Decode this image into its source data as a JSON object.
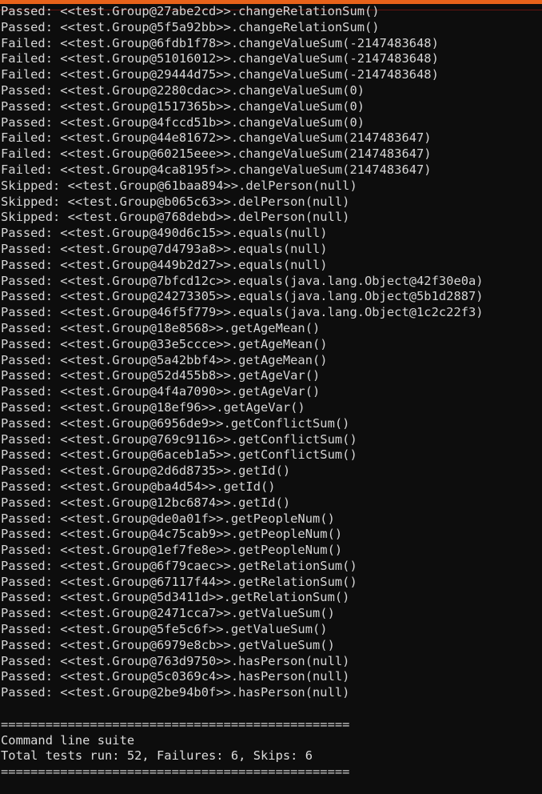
{
  "terminal": {
    "accent_color": "#e8621a",
    "background_color": "#0d0d0d",
    "text_color": "#d6d6d6",
    "font_label": "monospace-console"
  },
  "results": {
    "lines": [
      "Passed: <<test.Group@27abe2cd>>.changeRelationSum()",
      "Passed: <<test.Group@5f5a92bb>>.changeRelationSum()",
      "Failed: <<test.Group@6fdb1f78>>.changeValueSum(-2147483648)",
      "Failed: <<test.Group@51016012>>.changeValueSum(-2147483648)",
      "Failed: <<test.Group@29444d75>>.changeValueSum(-2147483648)",
      "Passed: <<test.Group@2280cdac>>.changeValueSum(0)",
      "Passed: <<test.Group@1517365b>>.changeValueSum(0)",
      "Passed: <<test.Group@4fccd51b>>.changeValueSum(0)",
      "Failed: <<test.Group@44e81672>>.changeValueSum(2147483647)",
      "Failed: <<test.Group@60215eee>>.changeValueSum(2147483647)",
      "Failed: <<test.Group@4ca8195f>>.changeValueSum(2147483647)",
      "Skipped: <<test.Group@61baa894>>.delPerson(null)",
      "Skipped: <<test.Group@b065c63>>.delPerson(null)",
      "Skipped: <<test.Group@768debd>>.delPerson(null)",
      "Passed: <<test.Group@490d6c15>>.equals(null)",
      "Passed: <<test.Group@7d4793a8>>.equals(null)",
      "Passed: <<test.Group@449b2d27>>.equals(null)",
      "Passed: <<test.Group@7bfcd12c>>.equals(java.lang.Object@42f30e0a)",
      "Passed: <<test.Group@24273305>>.equals(java.lang.Object@5b1d2887)",
      "Passed: <<test.Group@46f5f779>>.equals(java.lang.Object@1c2c22f3)",
      "Passed: <<test.Group@18e8568>>.getAgeMean()",
      "Passed: <<test.Group@33e5ccce>>.getAgeMean()",
      "Passed: <<test.Group@5a42bbf4>>.getAgeMean()",
      "Passed: <<test.Group@52d455b8>>.getAgeVar()",
      "Passed: <<test.Group@4f4a7090>>.getAgeVar()",
      "Passed: <<test.Group@18ef96>>.getAgeVar()",
      "Passed: <<test.Group@6956de9>>.getConflictSum()",
      "Passed: <<test.Group@769c9116>>.getConflictSum()",
      "Passed: <<test.Group@6aceb1a5>>.getConflictSum()",
      "Passed: <<test.Group@2d6d8735>>.getId()",
      "Passed: <<test.Group@ba4d54>>.getId()",
      "Passed: <<test.Group@12bc6874>>.getId()",
      "Passed: <<test.Group@de0a01f>>.getPeopleNum()",
      "Passed: <<test.Group@4c75cab9>>.getPeopleNum()",
      "Passed: <<test.Group@1ef7fe8e>>.getPeopleNum()",
      "Passed: <<test.Group@6f79caec>>.getRelationSum()",
      "Passed: <<test.Group@67117f44>>.getRelationSum()",
      "Passed: <<test.Group@5d3411d>>.getRelationSum()",
      "Passed: <<test.Group@2471cca7>>.getValueSum()",
      "Passed: <<test.Group@5fe5c6f>>.getValueSum()",
      "Passed: <<test.Group@6979e8cb>>.getValueSum()",
      "Passed: <<test.Group@763d9750>>.hasPerson(null)",
      "Passed: <<test.Group@5c0369c4>>.hasPerson(null)",
      "Passed: <<test.Group@2be94b0f>>.hasPerson(null)"
    ]
  },
  "summary": {
    "separator_top": "===============================================",
    "suite_name": "Command line suite",
    "totals_line": "Total tests run: 52, Failures: 6, Skips: 6",
    "separator_bottom": "===============================================",
    "total_tests_run": 52,
    "failures": 6,
    "skips": 6
  }
}
